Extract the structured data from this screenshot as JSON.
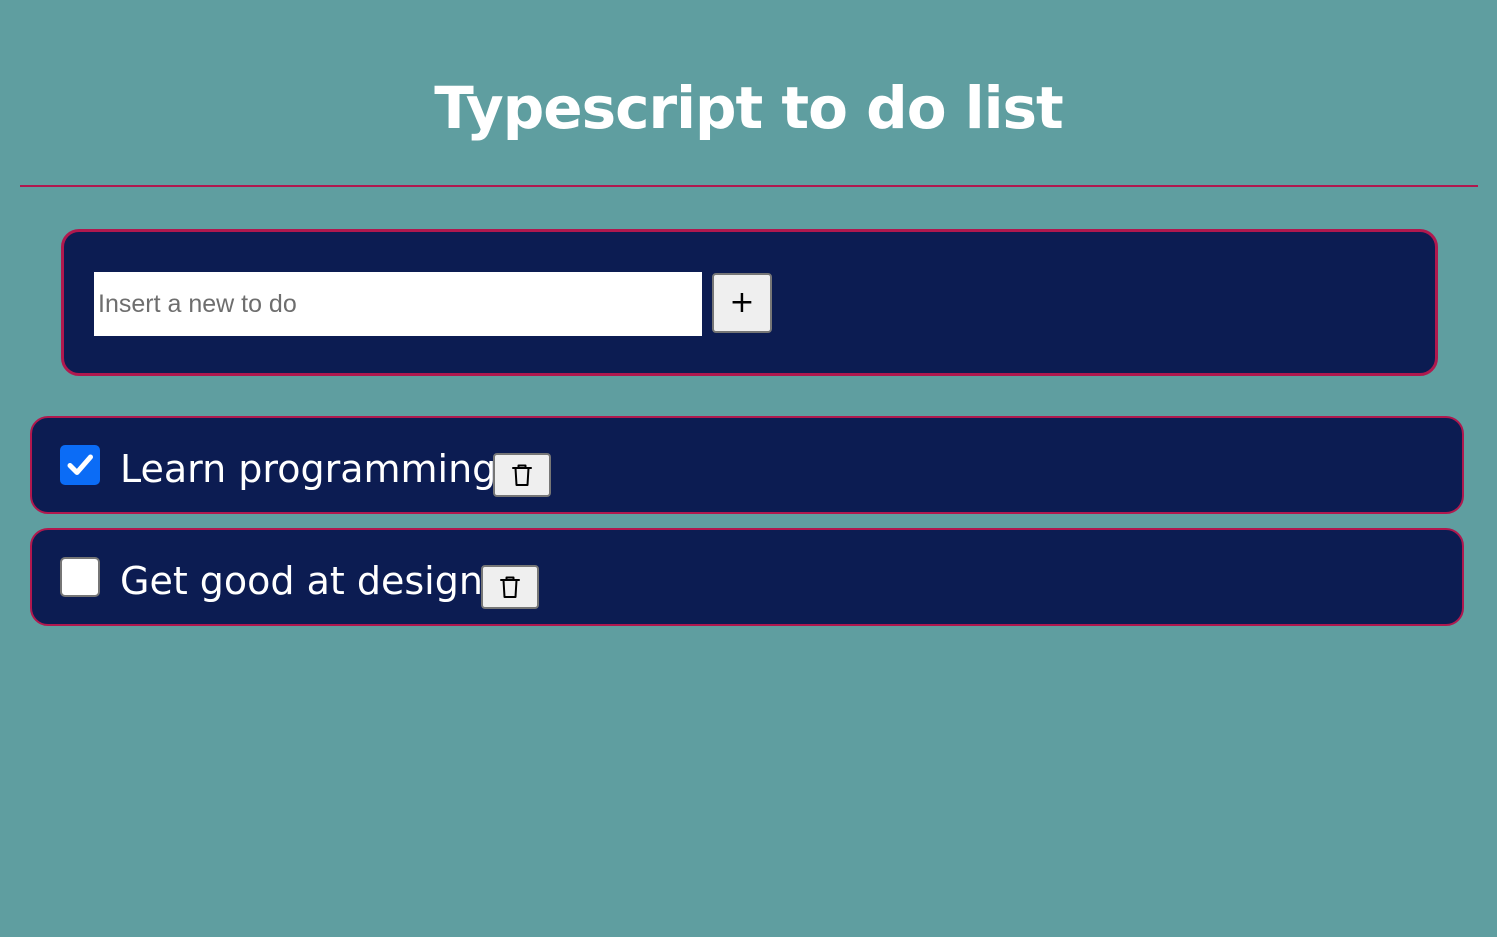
{
  "page": {
    "title": "Typescript to do list"
  },
  "add_form": {
    "input_value": "",
    "input_placeholder": "Insert a new to do",
    "add_button_label": "+"
  },
  "todos": [
    {
      "text": "Learn programming",
      "done": true,
      "delete_icon": "trash-icon"
    },
    {
      "text": "Get good at design",
      "done": false,
      "delete_icon": "trash-icon"
    }
  ],
  "colors": {
    "background": "#5f9ea0",
    "panel": "#0c1c52",
    "accent_border": "#b0184e",
    "checkbox_checked": "#0b6cf6"
  }
}
